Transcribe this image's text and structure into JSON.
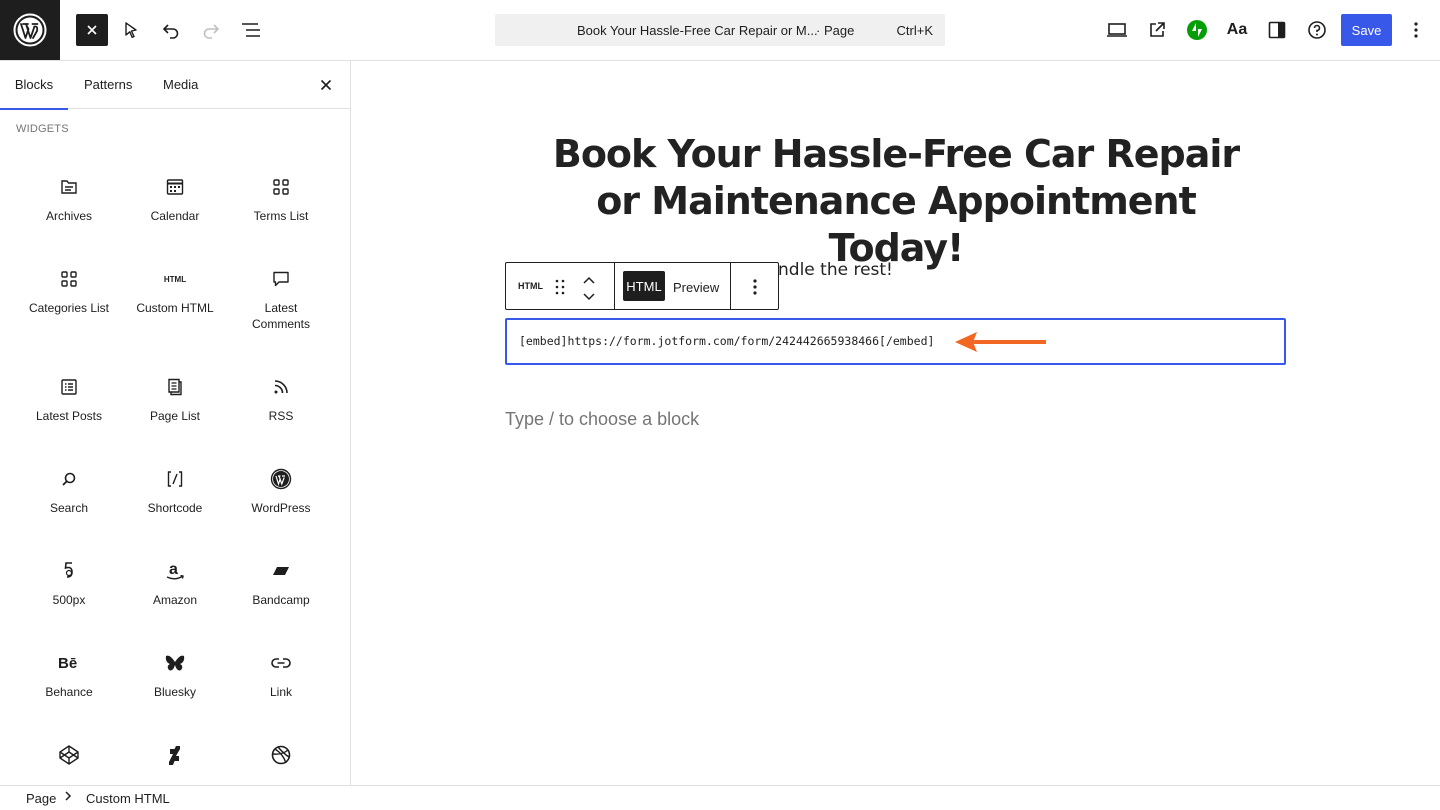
{
  "topbar": {
    "doc_title": "Book Your Hassle-Free Car Repair or M...",
    "doc_kind": "· Page",
    "shortcut": "Ctrl+K",
    "save_label": "Save",
    "styles_label": "Aa"
  },
  "sidebar": {
    "tabs": [
      {
        "label": "Blocks"
      },
      {
        "label": "Patterns"
      },
      {
        "label": "Media"
      }
    ],
    "section_label": "WIDGETS",
    "blocks": [
      {
        "label": "Archives",
        "icon": "archive-icon"
      },
      {
        "label": "Calendar",
        "icon": "calendar-icon"
      },
      {
        "label": "Terms List",
        "icon": "grid-icon"
      },
      {
        "label": "Categories List",
        "icon": "grid-icon"
      },
      {
        "label": "Custom HTML",
        "icon": "html-icon"
      },
      {
        "label": "Latest Comments",
        "icon": "comment-icon"
      },
      {
        "label": "Latest Posts",
        "icon": "list-icon"
      },
      {
        "label": "Page List",
        "icon": "pages-icon"
      },
      {
        "label": "RSS",
        "icon": "rss-icon"
      },
      {
        "label": "Search",
        "icon": "search-icon"
      },
      {
        "label": "Shortcode",
        "icon": "shortcode-icon"
      },
      {
        "label": "WordPress",
        "icon": "wordpress-icon"
      },
      {
        "label": "500px",
        "icon": "500px-icon"
      },
      {
        "label": "Amazon",
        "icon": "amazon-icon"
      },
      {
        "label": "Bandcamp",
        "icon": "bandcamp-icon"
      },
      {
        "label": "Behance",
        "icon": "behance-icon"
      },
      {
        "label": "Bluesky",
        "icon": "bluesky-icon"
      },
      {
        "label": "Link",
        "icon": "link-icon"
      },
      {
        "label": "",
        "icon": "codepen-icon"
      },
      {
        "label": "",
        "icon": "deviantart-icon"
      },
      {
        "label": "",
        "icon": "dribbble-icon"
      }
    ],
    "html_glyph": "HTML"
  },
  "canvas": {
    "heading": "Book Your Hassle-Free Car Repair or Maintenance Appointment Today!",
    "paragraph_visible": "ndle the rest!",
    "toolbar": {
      "block_label": "HTML",
      "html_button": "HTML",
      "preview_button": "Preview"
    },
    "code": "[embed]https://form.jotform.com/form/242442665938466[/embed]",
    "placeholder": "Type / to choose a block",
    "arrow_color": "#f26722"
  },
  "breadcrumb": {
    "root": "Page",
    "current": "Custom HTML"
  },
  "colors": {
    "accent": "#3858e9",
    "dark": "#1e1e1e",
    "jetpack": "#069e08"
  }
}
